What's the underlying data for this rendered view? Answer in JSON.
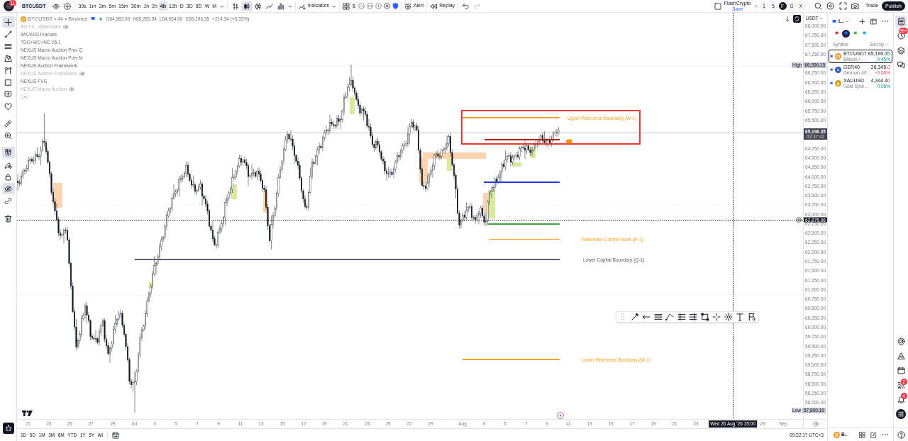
{
  "top_bar": {
    "notification_badge": "11",
    "symbol": "BTCUSDT",
    "intervals": [
      {
        "label": "30s",
        "selected": false
      },
      {
        "label": "1m",
        "selected": false
      },
      {
        "label": "3m",
        "selected": false
      },
      {
        "label": "5m",
        "selected": false
      },
      {
        "label": "15m",
        "selected": false
      },
      {
        "label": "30m",
        "selected": false
      },
      {
        "label": "1h",
        "selected": false
      },
      {
        "label": "2h",
        "selected": false
      },
      {
        "label": "4h",
        "selected": true
      },
      {
        "label": "12h",
        "selected": false
      },
      {
        "label": "D",
        "selected": false
      },
      {
        "label": "3D",
        "selected": false
      },
      {
        "label": "5D",
        "selected": false
      },
      {
        "label": "W",
        "selected": false
      },
      {
        "label": "M",
        "selected": false
      }
    ],
    "chart_types": [
      {
        "selected": false
      },
      {
        "selected": true
      },
      {
        "selected": false
      },
      {
        "selected": false
      },
      {
        "selected": false
      }
    ],
    "indicators_label": "Indicators",
    "currency_button": "$",
    "alert_label": "Alert",
    "replay_label": "Replay",
    "layout_name": "FlashCrypto",
    "layout_status": "Save",
    "layout_shortcuts": [
      {
        "label": "1",
        "selected": false
      },
      {
        "label": "5",
        "selected": false
      },
      {
        "label": "F",
        "selected": true
      },
      {
        "label": "G",
        "selected": false
      },
      {
        "label": "X",
        "selected": false
      }
    ],
    "trade_label": "Trade",
    "publish_label": "Publish"
  },
  "left_toolbar": {
    "tools": [
      {
        "selected": true
      },
      {
        "selected": false
      },
      {
        "selected": false
      },
      {
        "selected": false
      },
      {
        "selected": false
      },
      {
        "selected": false
      },
      {
        "selected": false
      },
      {
        "selected": false
      },
      {
        "selected": false
      },
      {
        "selected": false
      },
      {
        "selected": true
      },
      {
        "selected": false
      },
      {
        "selected": false
      },
      {
        "selected": true
      },
      {
        "selected": false
      },
      {
        "selected": false
      }
    ]
  },
  "legend": {
    "title": "BTCUSDT • 4h • Binance",
    "ohlc": [
      "O64,982.00",
      "H65,281.54",
      "L64,924.00",
      "C65,196.35"
    ],
    "change": "+214.34 (+0.33%)",
    "indicators": [
      {
        "name": "AG FX - Watermark",
        "visible": false
      },
      {
        "name": "WICKED Fractals",
        "visible": true
      },
      {
        "name": "TDO+WC+NC V5.1",
        "visible": true
      },
      {
        "name": "NEXUS Macro Auction Prev Q",
        "visible": true
      },
      {
        "name": "NEXUS Macro Auction Prev M",
        "visible": true
      },
      {
        "name": "NEXUS Auction Framework",
        "visible": true
      },
      {
        "name": "NEXUS Auction Framework",
        "visible": false
      },
      {
        "name": "NEXUS FVG",
        "visible": true
      },
      {
        "name": "NEXUS Macro Auction",
        "visible": false
      }
    ]
  },
  "chart": {
    "drawings": [
      {
        "kind": "rectangle",
        "color": "#e53935",
        "faint": false
      },
      {
        "kind": "level",
        "color": "#f7a21b",
        "faint": false,
        "label": "Upper Reference Boundary (W-1)"
      },
      {
        "kind": "level",
        "color": "#b71c1c",
        "faint": false
      },
      {
        "kind": "level",
        "color": "#1e3ce6",
        "faint": false
      },
      {
        "kind": "level",
        "color": "#43a047",
        "faint": false
      },
      {
        "kind": "level",
        "color": "#f7a21b",
        "faint": true,
        "label": "Reference Control Node (H-1)"
      },
      {
        "kind": "level",
        "color": "#5d606b",
        "faint": false,
        "label": "Lower Capital Boundary (Q-1)"
      },
      {
        "kind": "level",
        "color": "#f7a21b",
        "faint": false,
        "label": "Lower Reference Boundary (W-1)"
      }
    ]
  },
  "price_axis": {
    "currency": "USDT",
    "ticks": [
      "68,000.00",
      "67,750.00",
      "67,500.00",
      "67,250.00",
      "66,750.00",
      "66,500.00",
      "66,250.00",
      "66,000.00",
      "65,750.00",
      "65,500.00",
      "64,750.00",
      "64,500.00",
      "64,250.00",
      "64,000.00",
      "63,750.00",
      "63,500.00",
      "63,250.00",
      "63,000.00",
      "62,750.00",
      "62,500.00",
      "62,250.00",
      "62,000.00",
      "61,750.00",
      "61,500.00",
      "61,250.00",
      "61,000.00",
      "60,750.00",
      "60,500.00",
      "60,250.00",
      "60,000.00",
      "59,750.00",
      "59,500.00",
      "59,250.00",
      "59,000.00",
      "58,750.00",
      "58,500.00",
      "58,250.00",
      "58,000.00"
    ],
    "high_label": "High",
    "high_value": "66,956.15",
    "last_price": "65,196.35",
    "countdown": "03:37:42",
    "crosshair_price": "62,875.96",
    "low_label": "Low",
    "low_value": "57,800.19"
  },
  "time_axis": {
    "labels": [
      "21",
      "23",
      "25",
      "27",
      "29",
      "Jul",
      "3",
      "5",
      "7",
      "9",
      "11",
      "13",
      "15",
      "17",
      "19",
      "21",
      "23",
      "25",
      "27",
      "29",
      "Aug",
      "3",
      "5",
      "7",
      "9",
      "11",
      "13",
      "15",
      "17",
      "19",
      "21",
      "23",
      "29",
      "Sep"
    ],
    "crosshair_time": "Wed 26 Aug '26 15:00"
  },
  "bottom_bar": {
    "ranges": [
      "1D",
      "5D",
      "1M",
      "3M",
      "6M",
      "YTD",
      "1Y",
      "5Y",
      "All"
    ],
    "clock": "09:22:17 UTC+3"
  },
  "watchlist": {
    "list_name": "L..",
    "flags": [
      {
        "color": "#f23645",
        "selected": false
      },
      {
        "color": "#2962ff",
        "selected": true
      },
      {
        "color": "#4caf50",
        "selected": false
      },
      {
        "color": "#00bcd4",
        "selected": false
      }
    ],
    "column_label": "Symbol",
    "sort_label": "Sort by",
    "rows": [
      {
        "symbol": "BTCUSDT",
        "description": "Bitcoin / ...",
        "price": "65,196.35",
        "tick_up": true,
        "change": "0.45%",
        "change_up": true,
        "selected": true
      },
      {
        "symbol": "GER40",
        "description": "German 40 ...",
        "price": "26,345.0",
        "tick_up": false,
        "change": "−0.06%",
        "change_up": false,
        "selected": false
      },
      {
        "symbol": "XAUUSD",
        "description": "Gold Spot ...",
        "price": "4,344.40",
        "tick_up": false,
        "change": "0.06%",
        "change_up": true,
        "selected": false
      }
    ],
    "footer_symbol": "B.."
  },
  "right_sidebar": {
    "top_items": [
      {
        "selected": true
      },
      {
        "selected": false,
        "badge": "99+"
      },
      {
        "selected": false
      },
      {
        "selected": false
      }
    ],
    "broadcast_badge": "2",
    "bell_badge": "4"
  }
}
